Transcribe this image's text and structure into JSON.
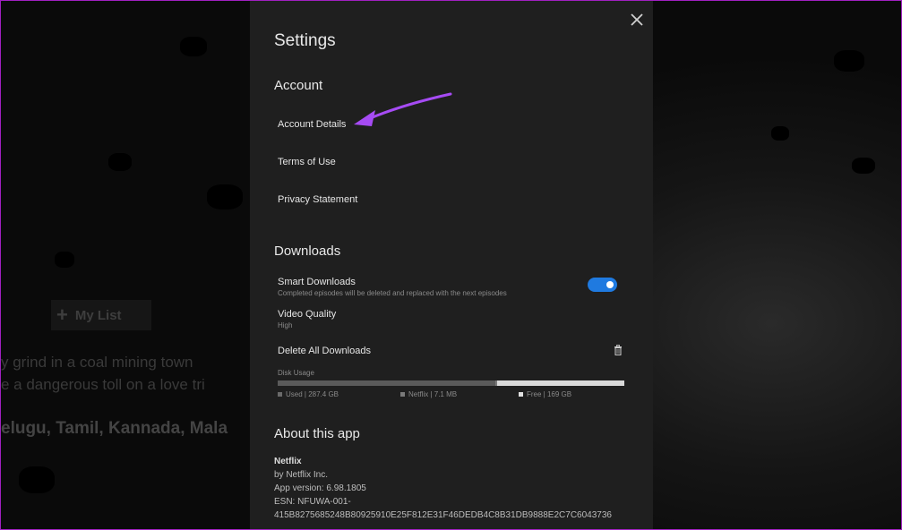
{
  "background": {
    "my_list_label": "My List",
    "lines": [
      "y grind in a coal mining town",
      "e a dangerous toll on a love tri",
      "elugu, Tamil, Kannada, Mala"
    ],
    "line_partial_4": "elugu."
  },
  "settings": {
    "title": "Settings",
    "account": {
      "heading": "Account",
      "items": [
        "Account Details",
        "Terms of Use",
        "Privacy Statement"
      ]
    },
    "downloads": {
      "heading": "Downloads",
      "smart_downloads": {
        "label": "Smart Downloads",
        "description": "Completed episodes will be deleted and replaced with the next episodes",
        "enabled": true
      },
      "video_quality": {
        "label": "Video Quality",
        "value": "High"
      },
      "delete_all_label": "Delete All Downloads",
      "disk_usage": {
        "label": "Disk Usage",
        "used": "Used | 287.4 GB",
        "netflix": "Netflix | 7.1 MB",
        "free": "Free | 169 GB",
        "used_fraction": 0.63,
        "netflix_fraction": 0.002,
        "free_fraction": 0.368
      }
    },
    "about": {
      "heading": "About this app",
      "app_name": "Netflix",
      "publisher": "by Netflix Inc.",
      "version": "App version: 6.98.1805",
      "esn_label": "ESN: NFUWA-001-",
      "esn_value": "415B8275685248B80925910E25F812E31F46DEDB4C8B31DB9888E2C7C6043736"
    }
  },
  "colors": {
    "panel_bg": "#1f1f1f",
    "toggle_on": "#1f7ae0",
    "annotation_arrow": "#a64bf4"
  },
  "icons": {
    "close": "close-icon",
    "delete": "trash-icon",
    "add": "plus-icon"
  }
}
